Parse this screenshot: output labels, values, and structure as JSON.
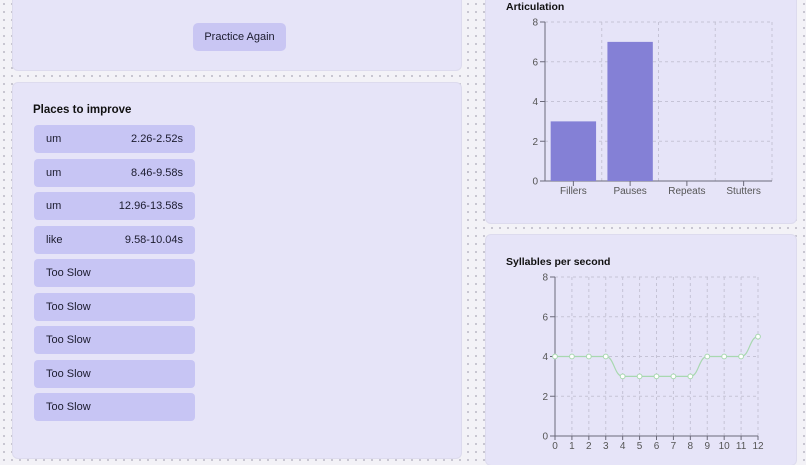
{
  "top_card": {
    "practice_again_label": "Practice Again"
  },
  "places": {
    "title": "Places to improve",
    "items": [
      {
        "word": "um",
        "time": "2.26-2.52s"
      },
      {
        "word": "um",
        "time": "8.46-9.58s"
      },
      {
        "word": "um",
        "time": "12.96-13.58s"
      },
      {
        "word": "like",
        "time": "9.58-10.04s"
      },
      {
        "word": "Too Slow",
        "time": ""
      },
      {
        "word": "Too Slow",
        "time": ""
      },
      {
        "word": "Too Slow",
        "time": ""
      },
      {
        "word": "Too Slow",
        "time": ""
      },
      {
        "word": "Too Slow",
        "time": ""
      }
    ]
  },
  "colors": {
    "card": "#e6e4f8",
    "item": "#c7c5f4",
    "bar": "#8480d6",
    "line": "#a8d8b0"
  },
  "chart_data": [
    {
      "type": "bar",
      "title": "Articulation",
      "categories": [
        "Fillers",
        "Pauses",
        "Repeats",
        "Stutters"
      ],
      "values": [
        3,
        7,
        0,
        0
      ],
      "ylim": [
        0,
        8
      ],
      "yticks": [
        0,
        2,
        4,
        6,
        8
      ],
      "grid": true
    },
    {
      "type": "line",
      "title": "Syllables per second",
      "x": [
        0,
        1,
        2,
        3,
        4,
        5,
        6,
        7,
        8,
        9,
        10,
        11,
        12
      ],
      "values": [
        4,
        4,
        4,
        4,
        3,
        3,
        3,
        3,
        3,
        4,
        4,
        4,
        5
      ],
      "ylim": [
        0,
        8
      ],
      "yticks": [
        0,
        2,
        4,
        6,
        8
      ],
      "grid": true
    }
  ]
}
